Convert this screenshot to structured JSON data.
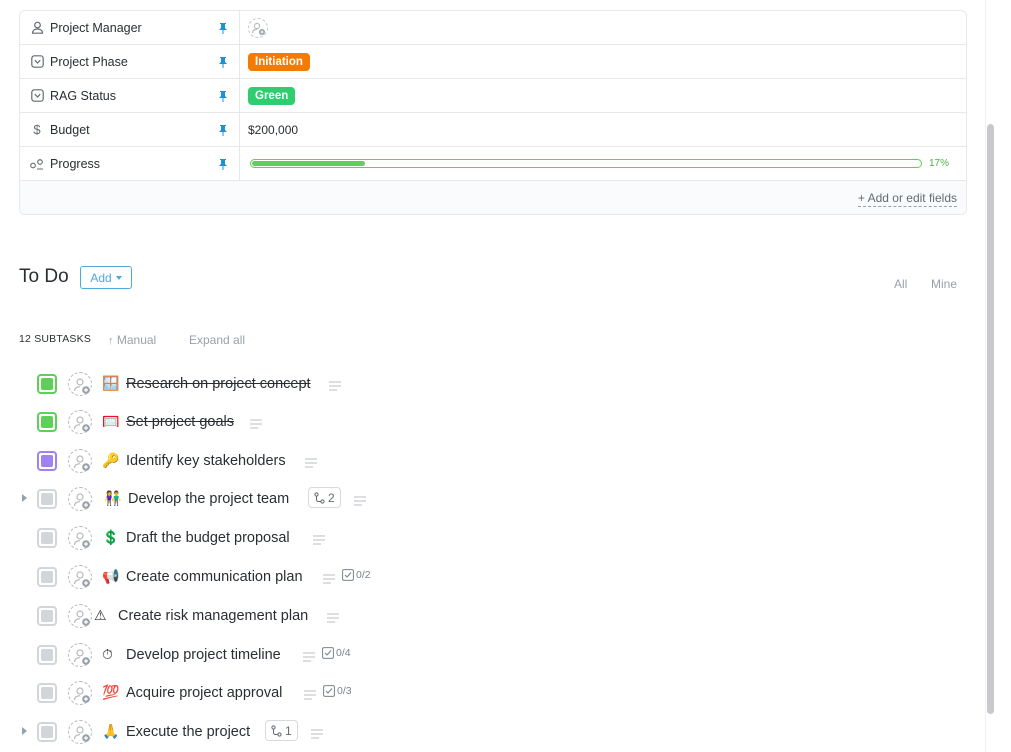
{
  "fields": [
    {
      "icon": "person-icon",
      "label": "Project Manager",
      "type": "assignee"
    },
    {
      "icon": "dropdown-field-icon",
      "label": "Project Phase",
      "type": "pill",
      "value": "Initiation",
      "color": "#f57b00"
    },
    {
      "icon": "dropdown-field-icon",
      "label": "RAG Status",
      "type": "pill",
      "value": "Green",
      "color": "#2ecd6f"
    },
    {
      "icon": "dollar-icon",
      "label": "Budget",
      "type": "text",
      "value": "$200,000"
    },
    {
      "icon": "progress-icon",
      "label": "Progress",
      "type": "progress",
      "percent": 17,
      "percent_label": "17%"
    }
  ],
  "fields_footer": {
    "add_edit_label": "+ Add or edit fields"
  },
  "todo": {
    "title": "To Do",
    "add_label": "Add",
    "filters": {
      "all": "All",
      "mine": "Mine"
    }
  },
  "subtasks_bar": {
    "count_label": "12 SUBTASKS",
    "sort_label": "Manual",
    "expand_label": "Expand all"
  },
  "tasks": [
    {
      "name": "Research on project concept",
      "emoji": "🪟",
      "status_color": "#5fcf5a",
      "done": true
    },
    {
      "name": "Set project goals",
      "emoji": "🥅",
      "status_color": "#5fcf5a",
      "done": true
    },
    {
      "name": "Identify key stakeholders",
      "emoji": "🔑",
      "status_color": "#a182f2",
      "done": false
    },
    {
      "name": "Develop the project team",
      "emoji": "👫",
      "status_color": "#d2d5d9",
      "done": false,
      "expandable": true,
      "subtask_count": "2"
    },
    {
      "name": "Draft the budget proposal",
      "emoji": "💲",
      "status_color": "#d2d5d9",
      "done": false
    },
    {
      "name": "Create communication plan",
      "emoji": "📢",
      "status_color": "#d2d5d9",
      "done": false,
      "checklist": "0/2"
    },
    {
      "name": "Create risk management plan",
      "emoji": "⚠",
      "status_color": "#d2d5d9",
      "done": false
    },
    {
      "name": "Develop project timeline",
      "emoji": "⏱",
      "status_color": "#d2d5d9",
      "done": false,
      "checklist": "0/4"
    },
    {
      "name": "Acquire project approval",
      "emoji": "💯",
      "status_color": "#d2d5d9",
      "done": false,
      "checklist": "0/3"
    },
    {
      "name": "Execute the project",
      "emoji": "🙏",
      "status_color": "#d2d5d9",
      "done": false,
      "expandable": true,
      "subtask_count": "1"
    }
  ]
}
